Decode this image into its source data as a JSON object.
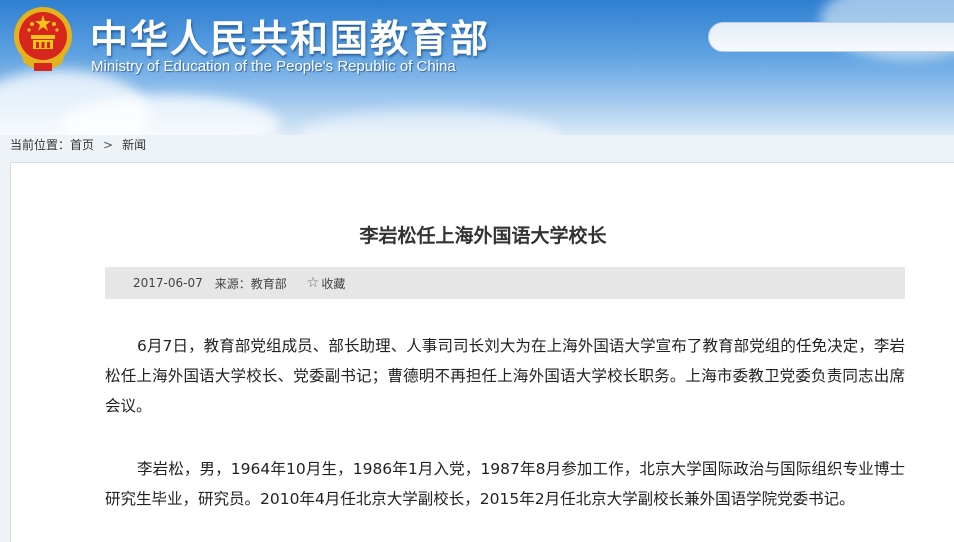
{
  "header": {
    "title": "中华人民共和国教育部",
    "subtitle": "Ministry of Education of the People's Republic of China",
    "search_placeholder": ""
  },
  "breadcrumb": {
    "label": "当前位置：",
    "home": "首页",
    "separator": ">",
    "current": "新闻"
  },
  "article": {
    "title": "李岩松任上海外国语大学校长",
    "date": "2017-06-07",
    "source": "来源：教育部",
    "favorite_label": "收藏",
    "favorite_icon": "star-outline-icon",
    "paragraphs": [
      "6月7日，教育部党组成员、部长助理、人事司司长刘大为在上海外国语大学宣布了教育部党组的任免决定，李岩松任上海外国语大学校长、党委副书记；曹德明不再担任上海外国语大学校长职务。上海市委教卫党委负责同志出席会议。",
      "李岩松，男，1964年10月生，1986年1月入党，1987年8月参加工作，北京大学国际政治与国际组织专业博士研究生毕业，研究员。2010年4月任北京大学副校长，2015年2月任北京大学副校长兼外国语学院党委书记。"
    ]
  },
  "colors": {
    "header_blue": "#2f7fd1",
    "emblem_red": "#d7261e",
    "emblem_gold": "#f5c518"
  }
}
